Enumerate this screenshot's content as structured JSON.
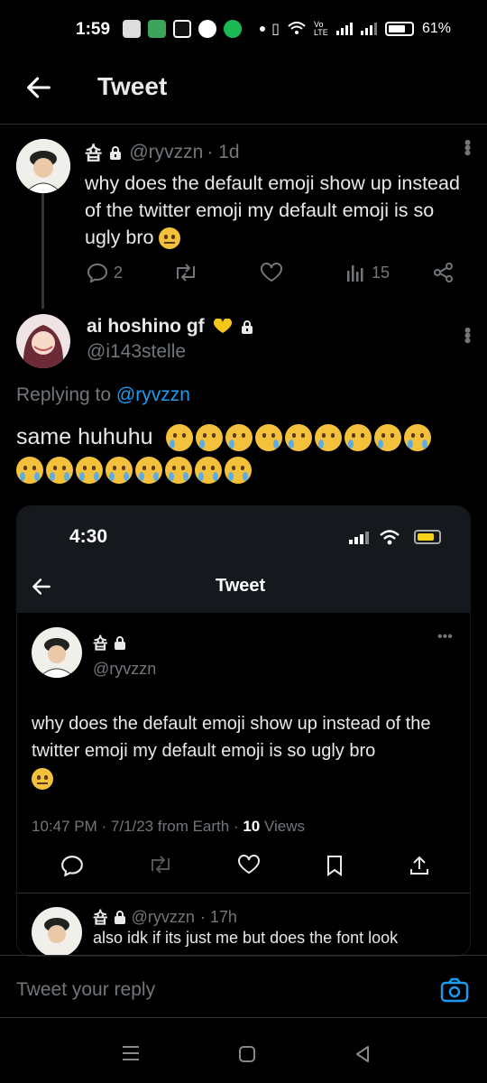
{
  "status_bar": {
    "time": "1:59",
    "battery": "61%",
    "network": "Vo LTE"
  },
  "header": {
    "title": "Tweet"
  },
  "tweet1": {
    "display_name": "숍",
    "handle": "@ryvzzn",
    "age": "· 1d",
    "text": "why does the default emoji show up instead of the twitter emoji my default emoji is so ugly bro",
    "replies": "2",
    "views": "15"
  },
  "tweet2": {
    "display_name": "ai hoshino gf",
    "handle": "@i143stelle",
    "replying_to_label": "Replying to",
    "replying_to_handle": "@ryvzzn",
    "text": "same huhuhu"
  },
  "embed": {
    "time": "4:30",
    "title": "Tweet",
    "display_name": "숍",
    "handle": "@ryvzzn",
    "text": "why does the default emoji show up instead of the twitter emoji my default emoji is so ugly bro",
    "meta_time": "10:47 PM · 7/1/23 from Earth · ",
    "views_count": "10",
    "views_label": "Views",
    "reply_name": "숍",
    "reply_handle": "@ryvzzn",
    "reply_age": "· 17h",
    "reply_text": "also idk if its just me but does the font look"
  },
  "reply_bar": {
    "placeholder": "Tweet your reply"
  },
  "colors": {
    "accent": "#1d9bf0",
    "muted": "#71767b",
    "background": "#000000",
    "heart_badge": "#f5c518"
  }
}
